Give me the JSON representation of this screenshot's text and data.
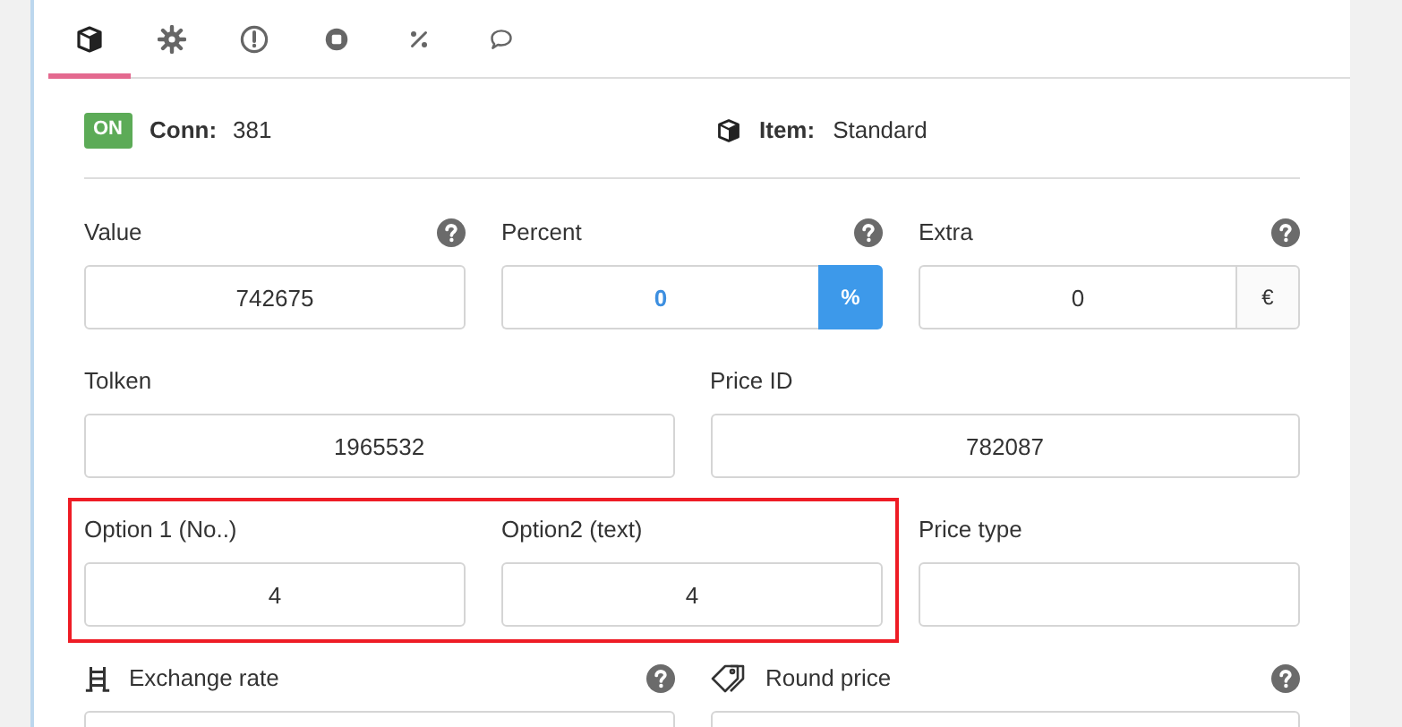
{
  "tabs": [
    {
      "selected": true
    },
    {
      "selected": false
    },
    {
      "selected": false
    },
    {
      "selected": false
    },
    {
      "selected": false
    },
    {
      "selected": false
    }
  ],
  "status": {
    "badge": "ON",
    "on": true,
    "conn_label": "Conn:",
    "conn_value": "381",
    "item_label": "Item:",
    "item_value": "Standard"
  },
  "rows": [
    {
      "items": [
        {
          "kind": "field",
          "label": "Value",
          "value": "742675",
          "help": true
        },
        {
          "kind": "field",
          "label": "Percent",
          "value": "0",
          "help": true,
          "addon": {
            "text": "%",
            "active": true
          }
        },
        {
          "kind": "field",
          "label": "Extra",
          "value": "0",
          "help": true,
          "addon": {
            "text": "€",
            "active": false
          }
        }
      ]
    },
    {
      "items": [
        {
          "kind": "field",
          "label": "Tolken",
          "value": "1965532",
          "help": false
        },
        {
          "kind": "field",
          "label": "Price ID",
          "value": "782087",
          "help": false
        }
      ]
    },
    {
      "items": [
        {
          "kind": "group",
          "highlighted": true,
          "fields": [
            {
              "label": "Option 1 (No..)",
              "value": "4",
              "help": false
            },
            {
              "label": "Option2 (text)",
              "value": "4",
              "help": false
            }
          ]
        },
        {
          "kind": "field",
          "label": "Price type",
          "help": false
        }
      ]
    },
    {
      "items": [
        {
          "kind": "field",
          "label": "Exchange rate",
          "help": true
        },
        {
          "kind": "field",
          "label": "Round price",
          "help": true
        }
      ]
    }
  ]
}
